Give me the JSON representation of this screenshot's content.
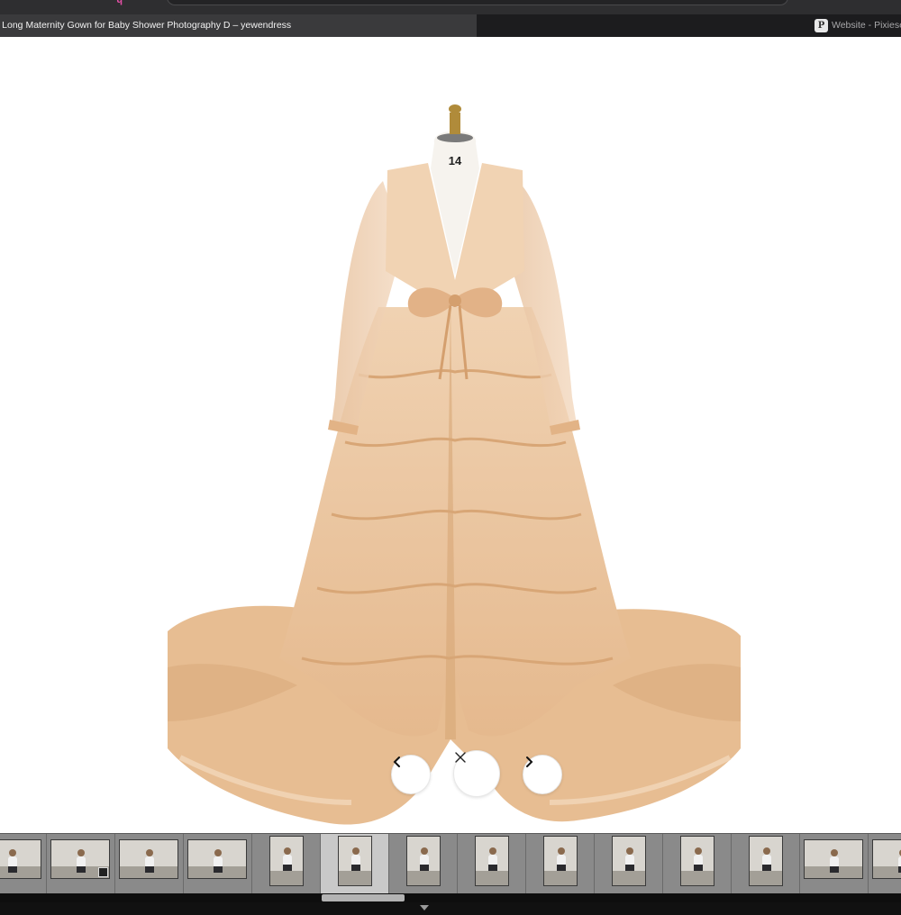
{
  "browser": {
    "active_tab": {
      "title": "s Long Maternity Gown for Baby Shower Photography D – yewendress"
    },
    "inactive_tab": {
      "favicon_letter": "P",
      "title": "Website - Pixiese"
    }
  },
  "viewer": {
    "product_image": {
      "subject": "tiered tulle maternity gown on dress form",
      "form_size_label": "14"
    },
    "controls": {
      "prev_icon": "chevron-left-icon",
      "close_icon": "close-icon",
      "next_icon": "chevron-right-icon"
    }
  },
  "filmstrip": {
    "selected_index": 5,
    "thumbnails": [
      {
        "orientation": "landscape"
      },
      {
        "orientation": "landscape",
        "badge": true
      },
      {
        "orientation": "landscape"
      },
      {
        "orientation": "landscape"
      },
      {
        "orientation": "portrait"
      },
      {
        "orientation": "portrait"
      },
      {
        "orientation": "portrait"
      },
      {
        "orientation": "portrait"
      },
      {
        "orientation": "portrait"
      },
      {
        "orientation": "portrait"
      },
      {
        "orientation": "portrait"
      },
      {
        "orientation": "portrait"
      },
      {
        "orientation": "landscape"
      },
      {
        "orientation": "landscape"
      }
    ]
  },
  "colors": {
    "gown_primary": "#e9c29a",
    "gown_shadow": "#d9a97b",
    "gown_highlight": "#f4d9bd",
    "chrome_dark": "#1c1c1e",
    "filmstrip": "#7d7d7d"
  }
}
